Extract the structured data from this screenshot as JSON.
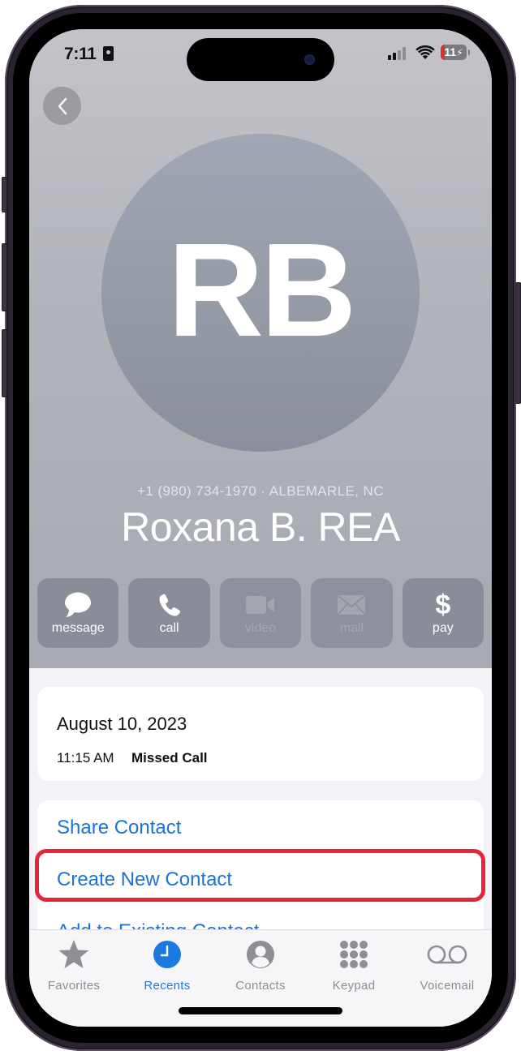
{
  "status_bar": {
    "time": "7:11",
    "battery_level": "11",
    "battery_charging": true
  },
  "header": {
    "back_label": "Back"
  },
  "contact": {
    "initials": "RB",
    "subtitle": "+1 (980) 734-1970 · ALBEMARLE, NC",
    "name": "Roxana B. REA"
  },
  "actions": [
    {
      "label": "message",
      "icon": "message-bubble-icon",
      "enabled": true
    },
    {
      "label": "call",
      "icon": "phone-icon",
      "enabled": true
    },
    {
      "label": "video",
      "icon": "video-camera-icon",
      "enabled": false
    },
    {
      "label": "mail",
      "icon": "envelope-icon",
      "enabled": false
    },
    {
      "label": "pay",
      "icon": "dollar-icon",
      "enabled": true
    }
  ],
  "call_history": {
    "date": "August 10, 2023",
    "time": "11:15 AM",
    "status": "Missed Call"
  },
  "contact_options": [
    {
      "label": "Share Contact"
    },
    {
      "label": "Create New Contact",
      "highlighted": true
    },
    {
      "label": "Add to Existing Contact"
    }
  ],
  "tabbar": {
    "tabs": [
      {
        "label": "Favorites",
        "icon": "star-icon",
        "active": false
      },
      {
        "label": "Recents",
        "icon": "clock-icon",
        "active": true
      },
      {
        "label": "Contacts",
        "icon": "person-circle-icon",
        "active": false
      },
      {
        "label": "Keypad",
        "icon": "keypad-grid-icon",
        "active": false
      },
      {
        "label": "Voicemail",
        "icon": "voicemail-icon",
        "active": false
      }
    ]
  },
  "colors": {
    "accent": "#1a73d9",
    "highlight_border": "#e8243b",
    "battery_low": "#e0322d",
    "tab_inactive": "#8e8e93"
  }
}
